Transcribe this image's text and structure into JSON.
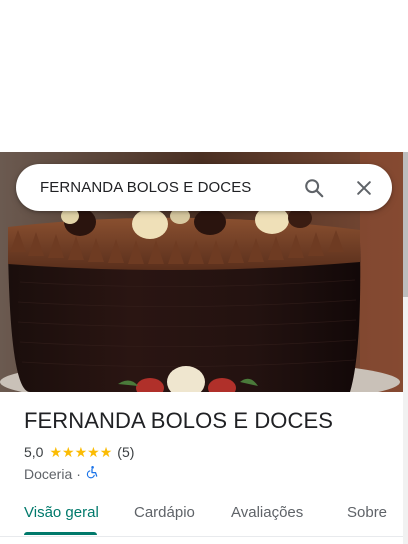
{
  "search": {
    "value": "FERNANDA BOLOS E DOCES"
  },
  "icons": {
    "search": "search-icon",
    "close": "close-icon",
    "accessibility": "wheelchair-icon",
    "star": "star-icon"
  },
  "place": {
    "name": "FERNANDA BOLOS E DOCES",
    "rating": "5,0",
    "stars": 5,
    "reviews": "(5)",
    "category": "Doceria",
    "separator": "·"
  },
  "tabs": [
    {
      "label": "Visão geral",
      "active": true
    },
    {
      "label": "Cardápio",
      "active": false
    },
    {
      "label": "Avaliações",
      "active": false
    },
    {
      "label": "Sobre",
      "active": false
    }
  ],
  "colors": {
    "accent": "#00796b",
    "star": "#fbbc04",
    "accessibility": "#1a73e8"
  }
}
